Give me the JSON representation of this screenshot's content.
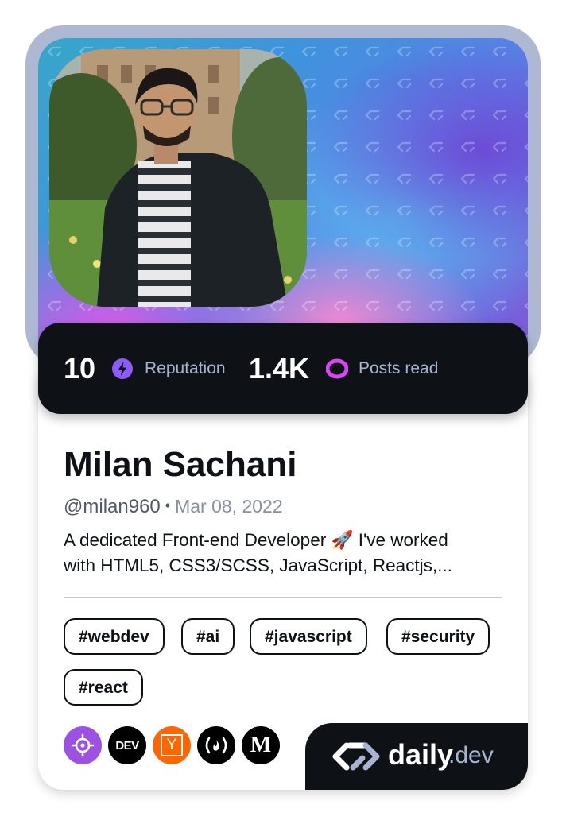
{
  "profile": {
    "name": "Milan Sachani",
    "handle": "@milan960",
    "joined": "Mar 08, 2022",
    "bio_line1": "A dedicated Front-end Developer 🚀 I've worked",
    "bio_line2": "with HTML5, CSS3/SCSS, JavaScript, Reactjs,..."
  },
  "stats": {
    "reputation_value": "10",
    "reputation_label": "Reputation",
    "posts_value": "1.4K",
    "posts_label": "Posts read"
  },
  "tags": [
    "#webdev",
    "#ai",
    "#javascript",
    "#security",
    "#react"
  ],
  "socials": [
    {
      "icon": "crosshair-icon",
      "color": "#9c51e3"
    },
    {
      "icon": "dev-icon",
      "label": "DEV",
      "color": "#000000"
    },
    {
      "icon": "hackernews-icon",
      "label": "Y",
      "color": "#ff6600"
    },
    {
      "icon": "freecodecamp-icon",
      "label": "(🔥)",
      "color": "#000000"
    },
    {
      "icon": "medium-icon",
      "label": "M",
      "color": "#000000"
    }
  ],
  "brand": {
    "daily": "daily",
    "dev": ".dev"
  },
  "colors": {
    "card_dark": "#0e1217",
    "reputation_icon": "#8b5cf6",
    "posts_icon": "#d946ef",
    "frame": "#aeb8d3"
  }
}
